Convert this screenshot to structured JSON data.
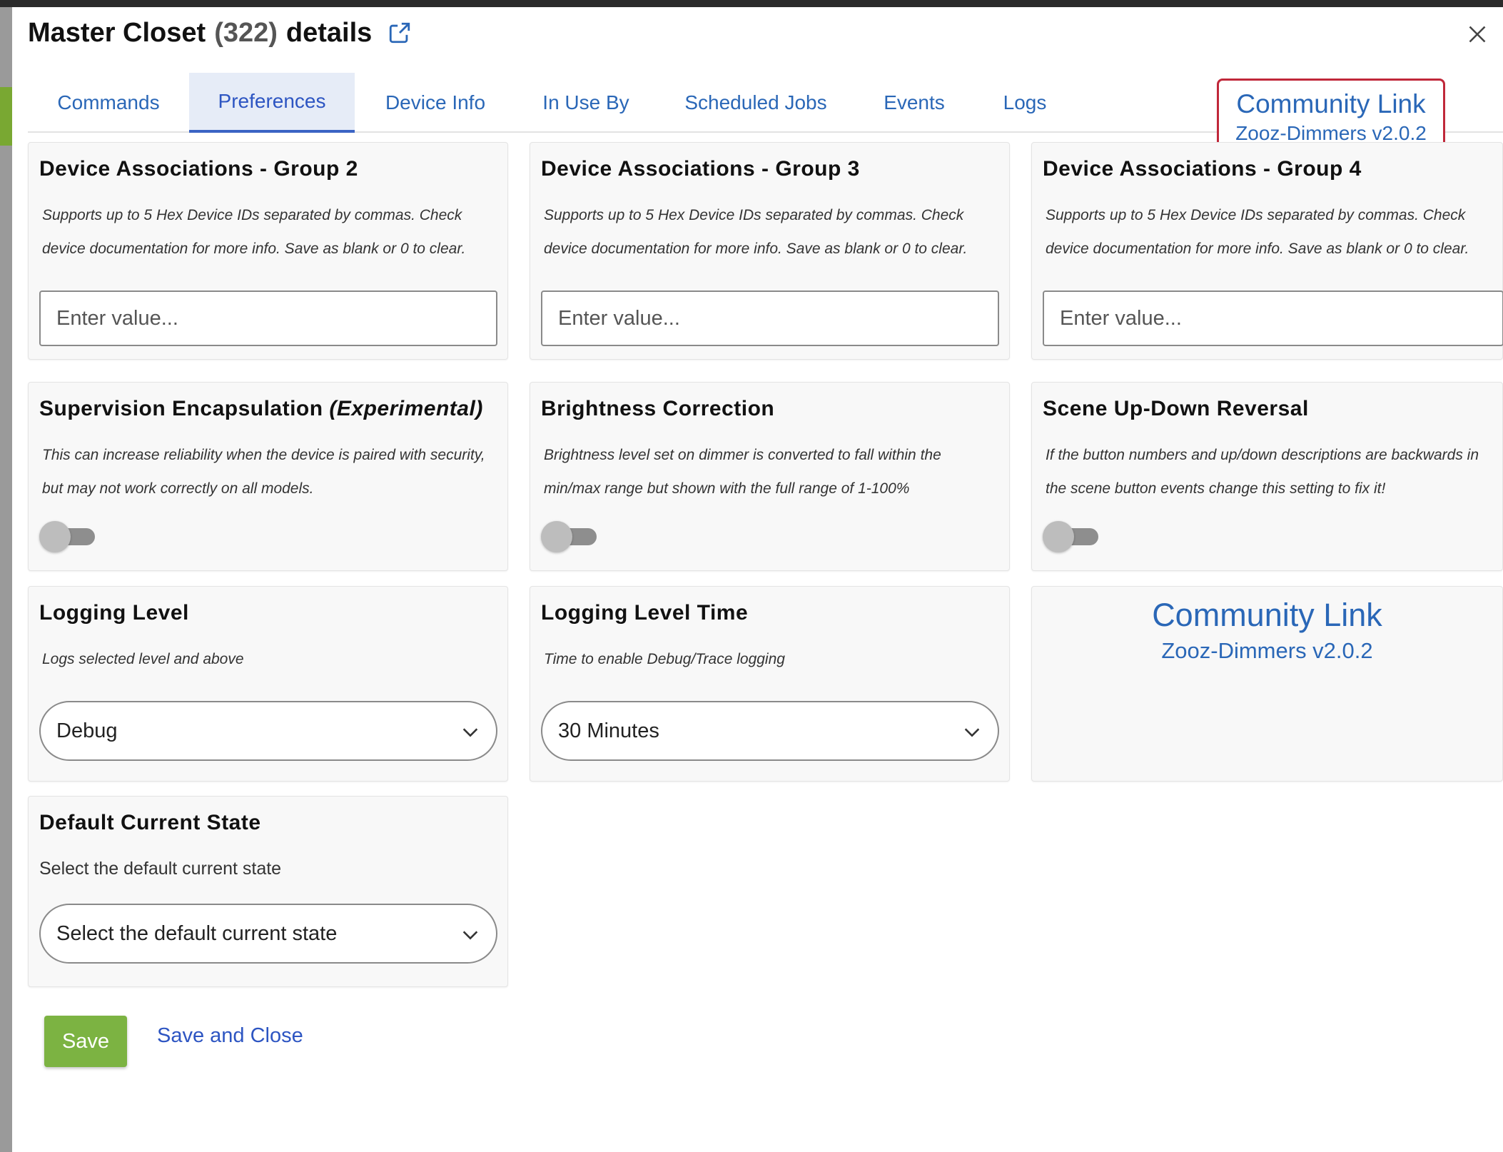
{
  "dialog": {
    "title_name": "Master Closet",
    "title_count": "(322)",
    "title_suffix": "details",
    "external_icon": "external-link-icon",
    "close_icon": "close-icon"
  },
  "tabs": [
    {
      "label": "Commands"
    },
    {
      "label": "Preferences"
    },
    {
      "label": "Device Info"
    },
    {
      "label": "In Use By"
    },
    {
      "label": "Scheduled Jobs"
    },
    {
      "label": "Events"
    },
    {
      "label": "Logs"
    }
  ],
  "active_tab": "Preferences",
  "community_tab": {
    "title": "Community Link",
    "subtitle": "Zooz-Dimmers v2.0.2"
  },
  "cards": {
    "assoc2": {
      "title": "Device Associations - Group 2",
      "desc": "Supports up to 5 Hex Device IDs separated by commas. Check device documentation for more info. Save as blank or 0 to clear.",
      "placeholder": "Enter value..."
    },
    "assoc3": {
      "title": "Device Associations - Group 3",
      "desc": "Supports up to 5 Hex Device IDs separated by commas. Check device documentation for more info. Save as blank or 0 to clear.",
      "placeholder": "Enter value..."
    },
    "assoc4": {
      "title": "Device Associations - Group 4",
      "desc": "Supports up to 5 Hex Device IDs separated by commas. Check device documentation for more info. Save as blank or 0 to clear.",
      "placeholder": "Enter value..."
    },
    "supervision": {
      "title": "Supervision Encapsulation",
      "title_em": "(Experimental)",
      "desc": "This can increase reliability when the device is paired with security, but may not work correctly on all models.",
      "enabled": false
    },
    "brightness": {
      "title": "Brightness Correction",
      "desc": "Brightness level set on dimmer is converted to fall within the min/max range but shown with the full range of 1-100%",
      "enabled": false
    },
    "scene": {
      "title": "Scene Up-Down Reversal",
      "desc": "If the button numbers and up/down descriptions are backwards in the scene button events change this setting to fix it!",
      "enabled": false
    },
    "logging": {
      "title": "Logging Level",
      "desc": "Logs selected level and above",
      "value": "Debug"
    },
    "logging_time": {
      "title": "Logging Level Time",
      "desc": "Time to enable Debug/Trace logging",
      "value": "30 Minutes"
    },
    "community": {
      "title": "Community Link",
      "subtitle": "Zooz-Dimmers v2.0.2"
    },
    "default_state": {
      "title": "Default Current State",
      "desc": "Select the default current state",
      "value": "Select the default current state"
    }
  },
  "footer": {
    "save_label": "Save",
    "save_close_label": "Save and Close"
  },
  "colors": {
    "link": "#2a67b7",
    "active_tab_bg": "#e6ecf7",
    "highlight_border": "#c0283a",
    "save_bg": "#7cb342"
  }
}
